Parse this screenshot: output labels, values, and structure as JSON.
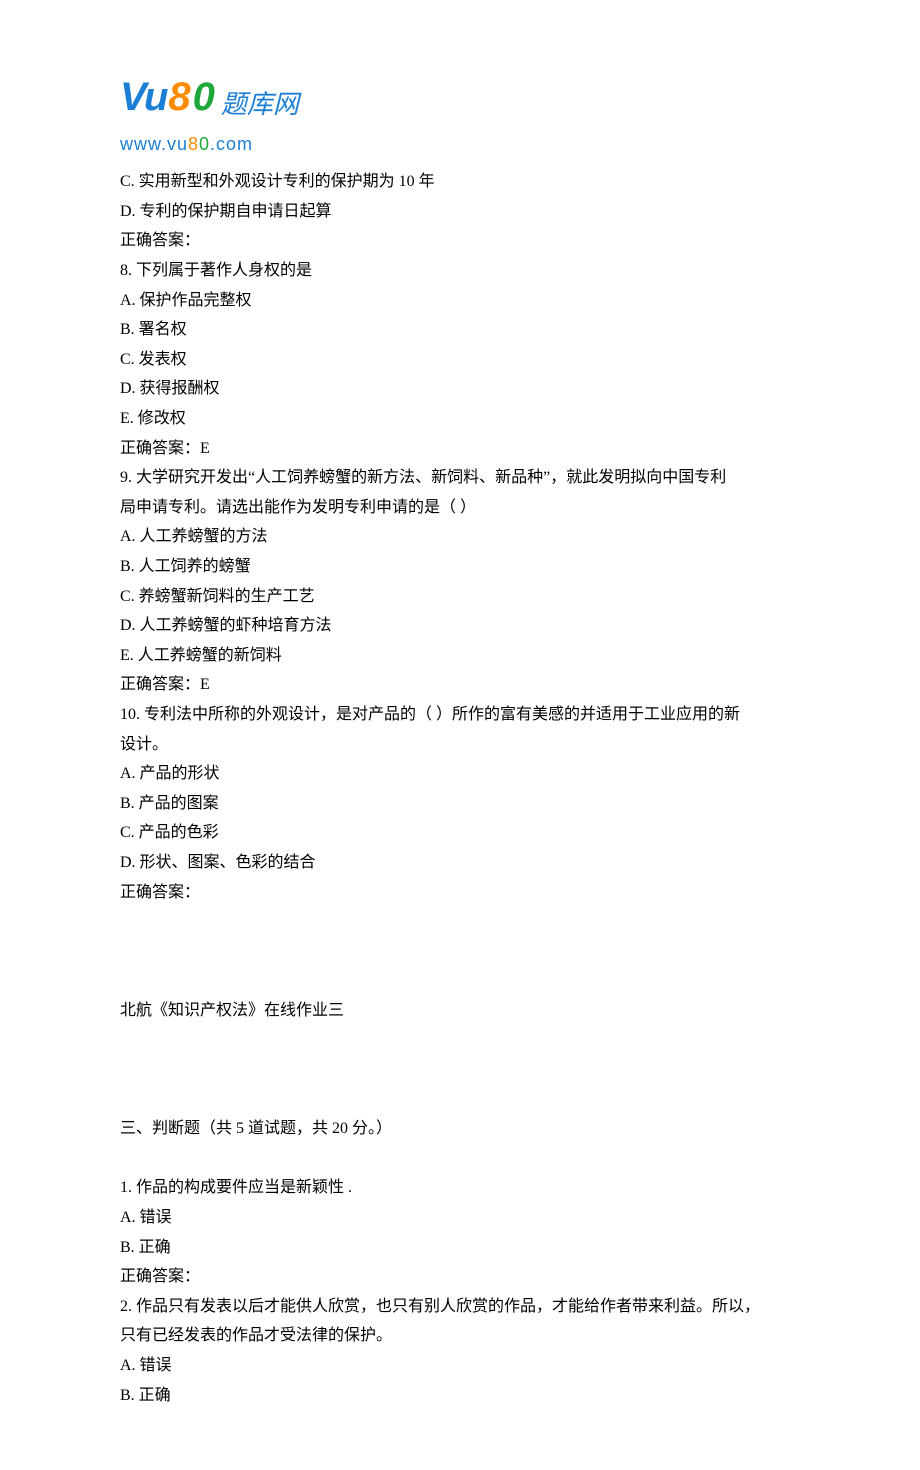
{
  "logo": {
    "vu": "Vu",
    "eight": "8",
    "zero": "0",
    "cn": "题库网",
    "url_prefix": "www.vu",
    "url_8": "8",
    "url_0": "0",
    "url_suffix": ".com"
  },
  "lines": {
    "q7c": "C. 实用新型和外观设计专利的保护期为 10 年",
    "q7d": "D. 专利的保护期自申请日起算",
    "q7ans": "正确答案：",
    "q8": "8.  下列属于著作人身权的是",
    "q8a": "A. 保护作品完整权",
    "q8b": "B. 署名权",
    "q8c": "C. 发表权",
    "q8d": "D. 获得报酬权",
    "q8e": "E. 修改权",
    "q8ans": "正确答案：E",
    "q9a_line": "9.  大学研究开发出“人工饲养螃蟹的新方法、新饲料、新品种”，就此发明拟向中国专利",
    "q9b_line": "局申请专利。请选出能作为发明专利申请的是（ ）",
    "q9a": "A. 人工养螃蟹的方法",
    "q9b": "B. 人工饲养的螃蟹",
    "q9c": "C. 养螃蟹新饲料的生产工艺",
    "q9d": "D. 人工养螃蟹的虾种培育方法",
    "q9e": "E. 人工养螃蟹的新饲料",
    "q9ans": "正确答案：E",
    "q10a_line": "10.  专利法中所称的外观设计，是对产品的（ ）所作的富有美感的并适用于工业应用的新",
    "q10b_line": "设计。",
    "q10a": "A. 产品的形状",
    "q10b": "B. 产品的图案",
    "q10c": "C. 产品的色彩",
    "q10d": "D. 形状、图案、色彩的结合",
    "q10ans": "正确答案：",
    "title2": "北航《知识产权法》在线作业三",
    "section3": "三、判断题（共 5 道试题，共 20 分。）",
    "j1": "1.  作品的构成要件应当是新颖性 .",
    "j1a": "A. 错误",
    "j1b": "B. 正确",
    "j1ans": "正确答案：",
    "j2a_line": "2.  作品只有发表以后才能供人欣赏，也只有别人欣赏的作品，才能给作者带来利益。所以，",
    "j2b_line": "只有已经发表的作品才受法律的保护。",
    "j2a": "A. 错误",
    "j2b": "B. 正确"
  }
}
